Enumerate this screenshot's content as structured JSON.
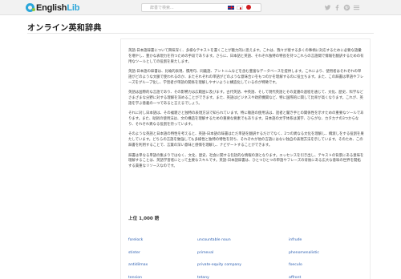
{
  "header": {
    "logo_prefix": "English",
    "logo_suffix": "Lib",
    "search_placeholder": "辞書で検索..."
  },
  "page": {
    "title": "オンライン英和辞典"
  },
  "intro": {
    "paragraphs": [
      "英語-日本語辞書について興味深く、多様なテキストを書くことが魅力的に思えます。これは、我々が接する多くの事柄に対応するために必要な語彙を増やし、豊かな表現力を持つための手段であります。さらに、日本語と英語、それぞれ独特の特長を持つこれらの言語間で情報を翻訳するための有用なツールとしての役割を果たします。",
      "英語-日本語の辞書は、比喩的表現、慣用句、同義語、アントニムなどを含む豊富なデータベースを提供します。これにより、使用者はそれぞれの単語がどのような文脈で使われるのか、またそれぞれの単語がどのような意味合いをもつのかを理解するのに役立ちます。また、この辞書は単語やフレーズをグループ化し、学習者が単語の関係を理解しやすいように構造化しているのが特徴です。",
      "英語は国際的な言語であり、その影響力は広範囲に及びます。古代英語、中英語、そして現代英語とその変遷の過程を通じて、文化、歴史、科学などさまざまな分野に対する理解を深めることができます。また、英語はビジネスや政府機関など、特に国際的に関して比率が高くなります。これが、英語を学ぶ意義の一つであると言えるでしょう。",
      "それに対し日本語は、その複雑さと独特の表現方法で知られています。特に敬語の使用法は、話者と聞き手との関係性を示すための重要なツールであります。また、助詞の使用法は、文の構造を理解するための重要な要素でもあります。日本語の文字体系は漢字、ひらがな、カタカナの3つからなり、それぞれ異なる役割を持っています。",
      "そのような英語と日本語の特性を考えると、英語-日本語の辞書はただ単語を翻訳するだけでなく、2つの異なる文化を理解し、橋渡しをする役割を果たしています。どちらの言語を勉強しても多様性と独特の特性を持ち、それぞれが他の言語にはない独自の表現方法を示しています。そのため、この辞書を利用することで、言葉の深い意味と感情を理解し、ナビゲートすることができます。",
      "辞書は単なる単語の集まりではなく、文化、歴史、社会に関する包括的な情報の源となります。エッセンスを引き出し、テキストの背景にある意味を理解することは、英語学習者にとって主要なスキルです。英語-日本語辞書は、ひとつひとつの単語やフレーズの背後にある広大な意味の世界を開拓する貴重なリソースなのです。"
    ]
  },
  "top_words": {
    "heading": "上位 1,000 語",
    "rows": [
      [
        "forelock",
        "uncountable noun",
        "infrude"
      ],
      [
        "stinter",
        "primeval",
        "phenomenalistic"
      ],
      [
        "antidilmax",
        "private-equity company",
        "foeculo"
      ],
      [
        "tension",
        "tetany",
        "affront"
      ]
    ]
  },
  "colors": {
    "link": "#2a5db0",
    "accent": "#2aa6d9"
  }
}
